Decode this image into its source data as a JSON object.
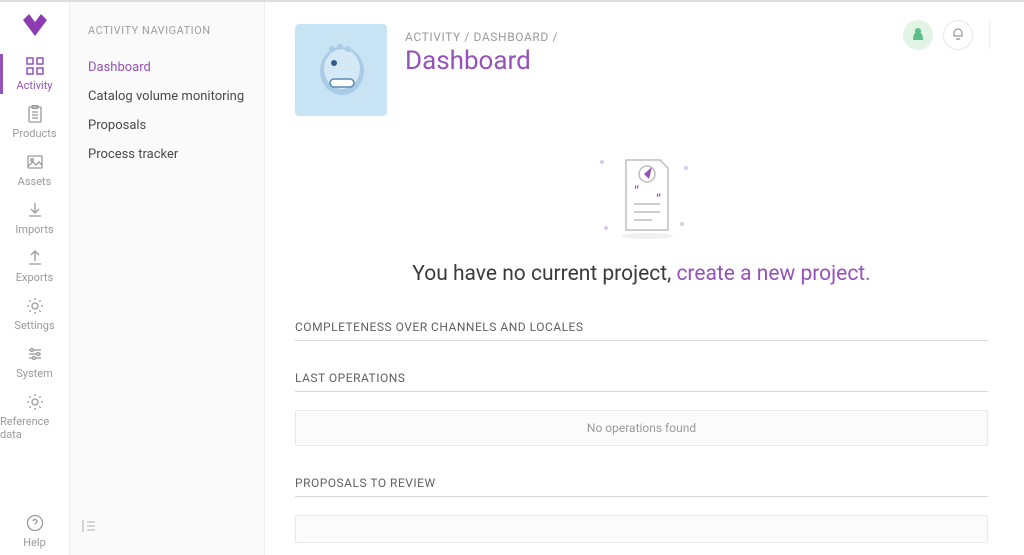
{
  "rail": {
    "items": [
      {
        "label": "Activity"
      },
      {
        "label": "Products"
      },
      {
        "label": "Assets"
      },
      {
        "label": "Imports"
      },
      {
        "label": "Exports"
      },
      {
        "label": "Settings"
      },
      {
        "label": "System"
      },
      {
        "label": "Reference data"
      }
    ],
    "help_label": "Help"
  },
  "sidebar": {
    "title": "ACTIVITY NAVIGATION",
    "items": [
      {
        "label": "Dashboard"
      },
      {
        "label": "Catalog volume monitoring"
      },
      {
        "label": "Proposals"
      },
      {
        "label": "Process tracker"
      }
    ]
  },
  "header": {
    "breadcrumb": "ACTIVITY / DASHBOARD /",
    "title": "Dashboard"
  },
  "empty": {
    "prefix": "You have no current project, ",
    "link": "create a new project.",
    "suffix": ""
  },
  "sections": {
    "completeness": "COMPLETENESS OVER CHANNELS AND LOCALES",
    "operations": "LAST OPERATIONS",
    "operations_empty": "No operations found",
    "proposals": "PROPOSALS TO REVIEW"
  }
}
